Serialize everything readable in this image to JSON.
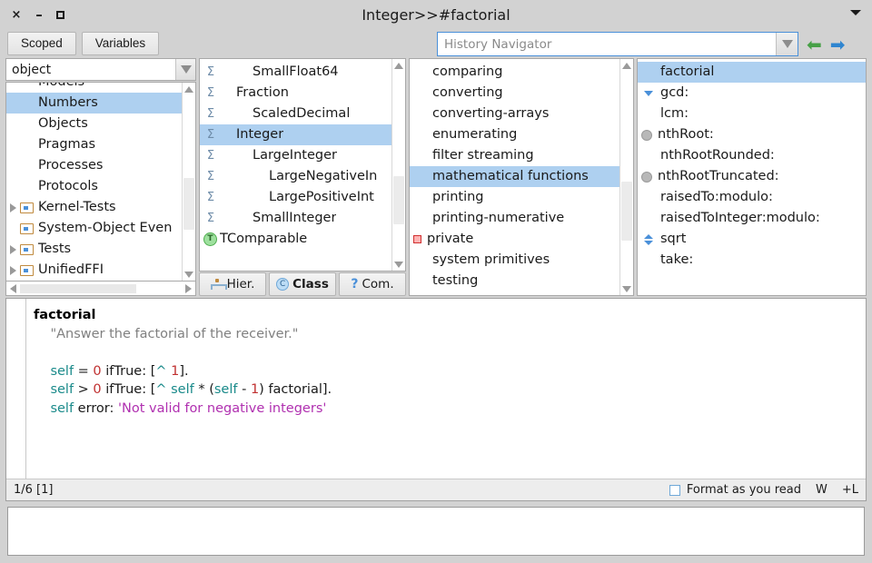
{
  "window": {
    "title": "Integer>>#factorial",
    "close_label": "×",
    "minimize_label": "–",
    "maximize_label": "",
    "menu_icon": "chevron-down-icon"
  },
  "toolbar": {
    "scoped_label": "Scoped",
    "variables_label": "Variables",
    "history_placeholder": "History Navigator",
    "history_value": "",
    "back_arrow": "⬅",
    "forward_arrow": "➡"
  },
  "packages": {
    "filter_value": "object",
    "items": [
      {
        "label": "Models",
        "indent": 1,
        "icon": "none",
        "expander": false,
        "selected": false,
        "clipped_top": true
      },
      {
        "label": "Numbers",
        "indent": 1,
        "icon": "none",
        "expander": false,
        "selected": true
      },
      {
        "label": "Objects",
        "indent": 1,
        "icon": "none",
        "expander": false,
        "selected": false
      },
      {
        "label": "Pragmas",
        "indent": 1,
        "icon": "none",
        "expander": false,
        "selected": false
      },
      {
        "label": "Processes",
        "indent": 1,
        "icon": "none",
        "expander": false,
        "selected": false
      },
      {
        "label": "Protocols",
        "indent": 1,
        "icon": "none",
        "expander": false,
        "selected": false
      },
      {
        "label": "Kernel-Tests",
        "indent": 0,
        "icon": "folder",
        "expander": true,
        "selected": false
      },
      {
        "label": "System-Object Even",
        "indent": 0,
        "icon": "folder",
        "expander": false,
        "selected": false
      },
      {
        "label": "Tests",
        "indent": 0,
        "icon": "folder",
        "expander": true,
        "selected": false
      },
      {
        "label": "UnifiedFFI",
        "indent": 0,
        "icon": "folder",
        "expander": true,
        "selected": false
      }
    ]
  },
  "classes": {
    "items": [
      {
        "label": "SmallFloat64",
        "indent": 2,
        "icon": "sigma",
        "selected": false
      },
      {
        "label": "Fraction",
        "indent": 1,
        "icon": "sigma",
        "selected": false
      },
      {
        "label": "ScaledDecimal",
        "indent": 2,
        "icon": "sigma",
        "selected": false
      },
      {
        "label": "Integer",
        "indent": 1,
        "icon": "sigma",
        "selected": true
      },
      {
        "label": "LargeInteger",
        "indent": 2,
        "icon": "sigma",
        "selected": false
      },
      {
        "label": "LargeNegativeIn",
        "indent": 3,
        "icon": "sigma",
        "selected": false
      },
      {
        "label": "LargePositiveInt",
        "indent": 3,
        "icon": "sigma",
        "selected": false
      },
      {
        "label": "SmallInteger",
        "indent": 2,
        "icon": "sigma",
        "selected": false
      },
      {
        "label": "TComparable",
        "indent": 0,
        "icon": "trait",
        "selected": false
      }
    ],
    "tabs": [
      {
        "label": "Hier.",
        "icon": "hierarchy-icon",
        "active": false
      },
      {
        "label": "Class",
        "icon": "class-icon",
        "active": true
      },
      {
        "label": "Com.",
        "icon": "question-icon",
        "active": false
      }
    ]
  },
  "protocols": {
    "items": [
      {
        "label": "comparing",
        "icon": "none",
        "selected": false
      },
      {
        "label": "converting",
        "icon": "none",
        "selected": false
      },
      {
        "label": "converting-arrays",
        "icon": "none",
        "selected": false
      },
      {
        "label": "enumerating",
        "icon": "none",
        "selected": false
      },
      {
        "label": "filter streaming",
        "icon": "none",
        "selected": false
      },
      {
        "label": "mathematical functions",
        "icon": "none",
        "selected": true
      },
      {
        "label": "printing",
        "icon": "none",
        "selected": false
      },
      {
        "label": "printing-numerative",
        "icon": "none",
        "selected": false
      },
      {
        "label": "private",
        "icon": "stop",
        "selected": false
      },
      {
        "label": "system primitives",
        "icon": "none",
        "selected": false
      },
      {
        "label": "testing",
        "icon": "none",
        "selected": false,
        "clipped_bottom": true
      }
    ]
  },
  "methods": {
    "items": [
      {
        "label": "factorial",
        "icon": "none",
        "selected": true
      },
      {
        "label": "gcd:",
        "icon": "override-down",
        "selected": false
      },
      {
        "label": "lcm:",
        "icon": "none",
        "selected": false
      },
      {
        "label": "nthRoot:",
        "icon": "gray-dot",
        "selected": false
      },
      {
        "label": "nthRootRounded:",
        "icon": "none",
        "selected": false
      },
      {
        "label": "nthRootTruncated:",
        "icon": "gray-dot",
        "selected": false
      },
      {
        "label": "raisedTo:modulo:",
        "icon": "none",
        "selected": false
      },
      {
        "label": "raisedToInteger:modulo:",
        "icon": "none",
        "selected": false
      },
      {
        "label": "sqrt",
        "icon": "override-updown",
        "selected": false
      },
      {
        "label": "take:",
        "icon": "none",
        "selected": false
      }
    ]
  },
  "editor": {
    "lines": [
      [
        {
          "t": "factorial",
          "c": "bold"
        }
      ],
      [
        {
          "t": "    ",
          "c": "plain"
        },
        {
          "t": "\"Answer the factorial of the receiver.\"",
          "c": "comment"
        }
      ],
      [
        {
          "t": "",
          "c": "plain"
        }
      ],
      [
        {
          "t": "    ",
          "c": "plain"
        },
        {
          "t": "self",
          "c": "selfkw"
        },
        {
          "t": " = ",
          "c": "plain"
        },
        {
          "t": "0",
          "c": "number"
        },
        {
          "t": " ifTrue: [",
          "c": "plain"
        },
        {
          "t": "^",
          "c": "caret"
        },
        {
          "t": " ",
          "c": "plain"
        },
        {
          "t": "1",
          "c": "number"
        },
        {
          "t": "].",
          "c": "plain"
        }
      ],
      [
        {
          "t": "    ",
          "c": "plain"
        },
        {
          "t": "self",
          "c": "selfkw"
        },
        {
          "t": " > ",
          "c": "plain"
        },
        {
          "t": "0",
          "c": "number"
        },
        {
          "t": " ifTrue: [",
          "c": "plain"
        },
        {
          "t": "^",
          "c": "caret"
        },
        {
          "t": " ",
          "c": "plain"
        },
        {
          "t": "self",
          "c": "selfkw"
        },
        {
          "t": " * (",
          "c": "plain"
        },
        {
          "t": "self",
          "c": "selfkw"
        },
        {
          "t": " - ",
          "c": "plain"
        },
        {
          "t": "1",
          "c": "number"
        },
        {
          "t": ") factorial].",
          "c": "plain"
        }
      ],
      [
        {
          "t": "    ",
          "c": "plain"
        },
        {
          "t": "self",
          "c": "selfkw"
        },
        {
          "t": " error: ",
          "c": "plain"
        },
        {
          "t": "'Not valid for negative integers'",
          "c": "string"
        }
      ]
    ],
    "status": {
      "position": "1/6 [1]",
      "format_label": "Format as you read",
      "format_checked": false,
      "w_label": "W",
      "plus_l_label": "+L"
    }
  },
  "bottom_input": {
    "value": "",
    "placeholder": ""
  },
  "colors": {
    "selection": "#aed0f0",
    "accent_blue": "#4a90d9",
    "window_bg": "#d2d2d2",
    "string": "#b030b0",
    "number": "#c03030",
    "self_keyword": "#1a8a8a",
    "comment": "#808080"
  }
}
